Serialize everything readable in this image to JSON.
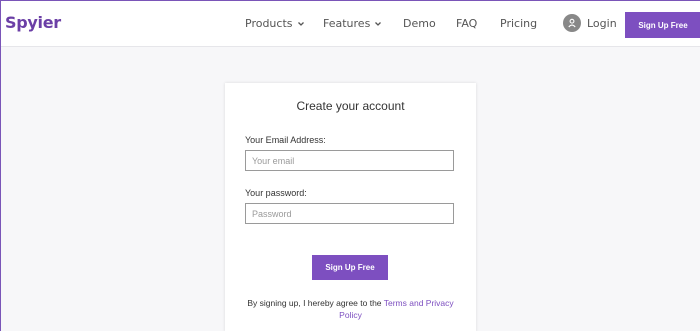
{
  "navbar": {
    "logo": "Spyier",
    "items": [
      {
        "label": "Products"
      },
      {
        "label": "Features"
      },
      {
        "label": "Demo"
      },
      {
        "label": "FAQ"
      },
      {
        "label": "Pricing"
      }
    ],
    "login_label": "Login",
    "signup_label": "Sign Up Free"
  },
  "form": {
    "title": "Create your account",
    "email_label": "Your Email Address:",
    "email_placeholder": "Your email",
    "email_value": "",
    "password_label": "Your password:",
    "password_placeholder": "Password",
    "password_value": "",
    "submit_label": "Sign Up Free",
    "terms_prefix": "By signing up, I hereby agree to the ",
    "terms_link": "Terms and Privacy",
    "terms_link_2": "Policy"
  },
  "colors": {
    "brand": "#6b3fa6",
    "button": "#7d4fc0"
  }
}
